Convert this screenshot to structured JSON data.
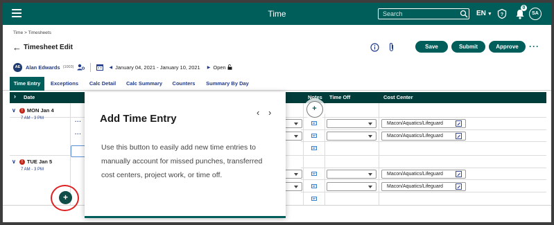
{
  "topbar": {
    "title": "Time",
    "search_placeholder": "Search",
    "language": "EN",
    "notification_count": "0",
    "user_initials": "SA"
  },
  "header": {
    "breadcrumb": "Time > Timesheets",
    "page_title": "Timesheet Edit",
    "save_label": "Save",
    "submit_label": "Submit",
    "approve_label": "Approve",
    "more_label": "···"
  },
  "employee": {
    "initials": "AE",
    "name": "Alan Edwards",
    "id": "(1003)",
    "period": "January 04, 2021 - January 10, 2021",
    "status": "Open"
  },
  "tabs": [
    {
      "label": "Time Entry"
    },
    {
      "label": "Exceptions"
    },
    {
      "label": "Calc Detail"
    },
    {
      "label": "Calc Summary"
    },
    {
      "label": "Counters"
    },
    {
      "label": "Summary By Day"
    }
  ],
  "grid": {
    "col_date": "Date",
    "col_notes": "Notes",
    "col_timeoff": "Time Off",
    "col_cost_center": "Cost Center",
    "days": [
      {
        "label": "MON Jan 4",
        "hours": "7 AM - 3 PM",
        "error": "!"
      },
      {
        "label": "TUE Jan 5",
        "hours": "7 AM - 3 PM",
        "error": "!"
      }
    ],
    "row_menu": "···",
    "cost_center_value": "Macon/Aquatics/Lifeguard"
  },
  "popover": {
    "title": "Add Time Entry",
    "prev": "‹",
    "next": "›",
    "body": "Use this button to easily add new time entries to manually account for missed punches, transferred cost centers, project work, or time off."
  },
  "add_button": "+",
  "colors": {
    "brand_teal": "#005e5a",
    "grid_header": "#003c3a",
    "link_blue": "#1f3a8c",
    "error_red": "#c0281c",
    "highlight_red": "#e02020"
  }
}
